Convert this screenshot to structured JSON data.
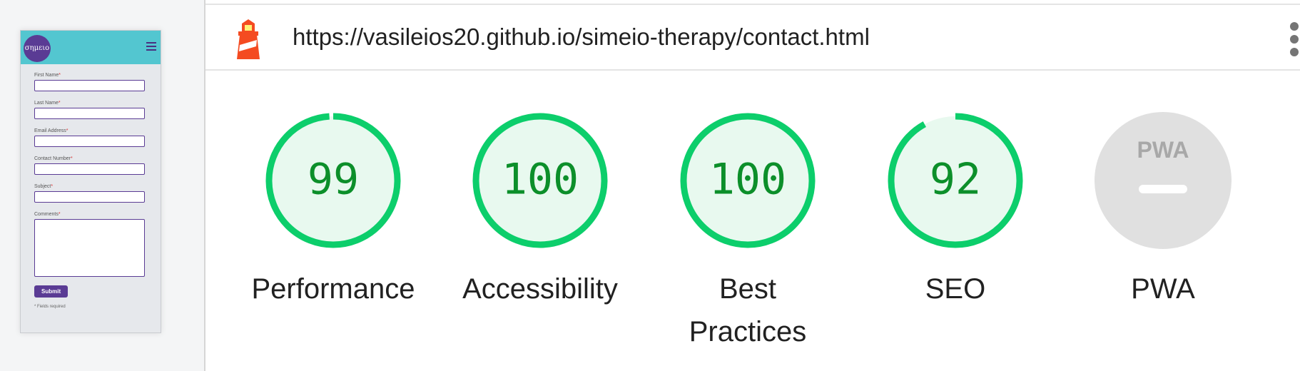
{
  "preview": {
    "logo_text": "σημειο",
    "form": {
      "fields": [
        {
          "label": "First Name",
          "required_mark": "*"
        },
        {
          "label": "Last Name",
          "required_mark": "*"
        },
        {
          "label": "Email Address",
          "required_mark": "*"
        },
        {
          "label": "Contact Number",
          "required_mark": "*"
        },
        {
          "label": "Subject",
          "required_mark": "*"
        }
      ],
      "comments_label": "Comments",
      "comments_required_mark": "*",
      "submit_label": "Submit",
      "note": "* Fields required"
    },
    "colors": {
      "header": "#53c6d0",
      "accent": "#5a3b94"
    }
  },
  "report": {
    "url": "https://vasileios20.github.io/simeio-therapy/contact.html",
    "icons": {
      "app": "lighthouse-icon",
      "menu": "more-vert-icon"
    },
    "categories": [
      {
        "id": "performance",
        "label": "Performance",
        "score": 99,
        "display": "99"
      },
      {
        "id": "accessibility",
        "label": "Accessibility",
        "score": 100,
        "display": "100"
      },
      {
        "id": "best-practices",
        "label": "Best Practices",
        "score": 100,
        "display": "100"
      },
      {
        "id": "seo",
        "label": "SEO",
        "score": 92,
        "display": "92"
      },
      {
        "id": "pwa",
        "label": "PWA",
        "score": null,
        "display": "PWA"
      }
    ],
    "colors": {
      "pass": "#0cce6b",
      "pass_fill": "#e8f9ef",
      "score_text": "#0c8f2a",
      "na": "#e0e0e0"
    }
  }
}
